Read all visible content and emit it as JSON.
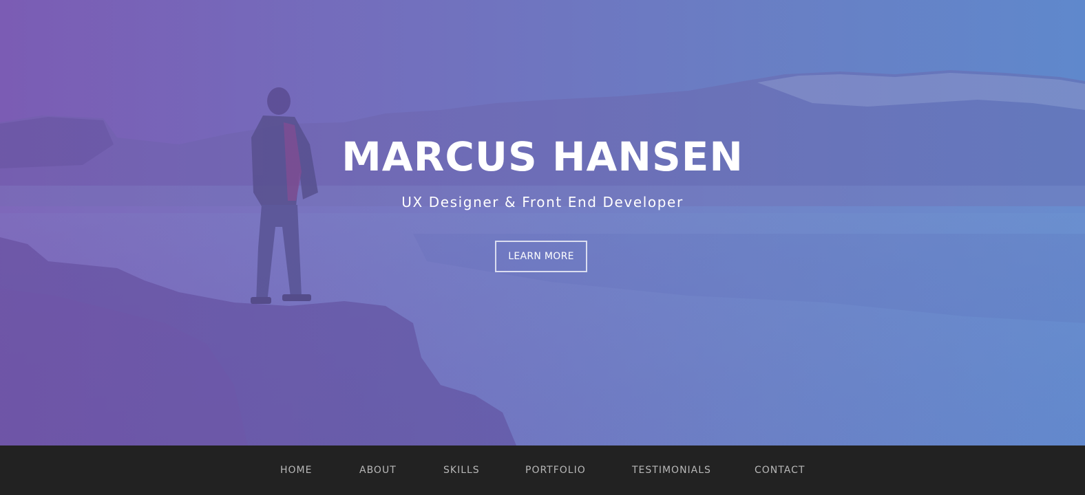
{
  "hero": {
    "title": "MARCUS HANSEN",
    "subtitle": "UX Designer & Front End Developer",
    "cta_label": "LEARN MORE"
  },
  "nav": {
    "items": [
      {
        "label": "HOME"
      },
      {
        "label": "ABOUT"
      },
      {
        "label": "SKILLS"
      },
      {
        "label": "PORTFOLIO"
      },
      {
        "label": "TESTIMONIALS"
      },
      {
        "label": "CONTACT"
      }
    ]
  },
  "colors": {
    "gradient_left": "#7b5cb4",
    "gradient_right": "#5f88cc",
    "navbar_bg": "#222222",
    "nav_text": "#b8b8b8",
    "hero_text": "#ffffff"
  }
}
